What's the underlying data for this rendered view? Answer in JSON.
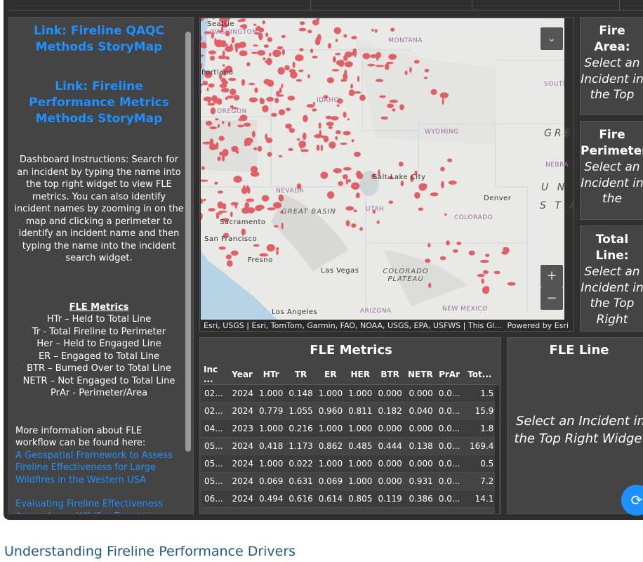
{
  "left_panel": {
    "link1": "Link: Fireline QAQC Methods StoryMap",
    "link2": "Link: Fireline Performance Metrics Methods StoryMap",
    "instructions": "Dashboard Instructions: Search for an incident by typing the name into the top right widget to view FLE metrics. You can also identify incident names by zooming in on the map and clicking a perimeter to identify an incident name and then typing the name into the incident search widget.",
    "metrics_title": "FLE Metrics",
    "metric_defs": [
      "HTr – Held to Total Line",
      "Tr - Total Fireline to Perimeter",
      "Her – Held to Engaged Line",
      "ER – Engaged to Total Line",
      "BTR – Burned Over to Total Line",
      "NETR – Not Engaged to Total Line",
      "PrAr - Perimeter/Area"
    ],
    "more_info": "More information about FLE workflow can be found here:",
    "link3": "A Geospatial Framework to Assess Fireline Effectiveness for Large Wildfires in the Western USA",
    "link4": "Evaluating Fireline Effectiveness Across Large Wildfire Events in"
  },
  "map": {
    "labels": {
      "washington": "WASHINGTON",
      "montana": "MONTANA",
      "idaho": "IDAHO",
      "oregon": "OREGON",
      "wyoming": "WYOMING",
      "nevada": "NEVADA",
      "utah": "UTAH",
      "colorado": "COLORADO",
      "arizona": "ARIZONA",
      "new_mexico": "NEW MEXICO",
      "south_dakota": "SOUTH DAKOTA",
      "nebraska": "NEBRA",
      "seattle": "Seattle",
      "portland": "Portland",
      "salt_lake": "Salt Lake City",
      "denver": "Denver",
      "sacramento": "Sacramento",
      "san_francisco": "San Francisco",
      "fresno": "Fresno",
      "las_vegas": "Las Vegas",
      "los_angeles": "Los Angeles",
      "great_basin": "GREAT BASIN",
      "colorado_plateau": "COLORADO PLATEAU",
      "great_plains": "GRE",
      "united_states": "U N",
      "united_states2": "S T A"
    },
    "attribution": "Esri, USGS | Esri, TomTom, Garmin, FAO, NOAA, USGS, EPA, USFWS | This Gl...",
    "powered_by": "Powered by Esri",
    "zoom_in": "+",
    "zoom_out": "−",
    "collapse_icon": "chevron-double-down-icon",
    "fire_color": "#e0525a"
  },
  "cards": {
    "fire_area": {
      "title": "Fire Area:",
      "subtitle": "Select an Incident in the Top"
    },
    "fire_perimeter": {
      "title": "Fire Perimeter:",
      "subtitle": "Select an Incident in the"
    },
    "total_line": {
      "title": "Total Line:",
      "subtitle": "Select an Incident in the Top Right"
    }
  },
  "metrics_table": {
    "title": "FLE Metrics",
    "headers": [
      "Inc ...",
      "Year",
      "HTr",
      "TR",
      "ER",
      "HER",
      "BTR",
      "NETR",
      "PrAr",
      "Tot..."
    ],
    "rows": [
      [
        "02...",
        "2024",
        "1.000",
        "0.148",
        "1.000",
        "1.000",
        "0.000",
        "0.000",
        "0.0...",
        "1.5"
      ],
      [
        "02...",
        "2024",
        "0.779",
        "1.055",
        "0.960",
        "0.811",
        "0.182",
        "0.040",
        "0.0...",
        "15.9"
      ],
      [
        "04...",
        "2023",
        "1.000",
        "0.216",
        "1.000",
        "1.000",
        "0.000",
        "0.000",
        "0.0...",
        "1.8"
      ],
      [
        "05...",
        "2024",
        "0.418",
        "1.173",
        "0.862",
        "0.485",
        "0.444",
        "0.138",
        "0.0...",
        "169.4"
      ],
      [
        "05...",
        "2024",
        "1.000",
        "0.022",
        "1.000",
        "1.000",
        "0.000",
        "0.000",
        "0.0...",
        "0.5"
      ],
      [
        "05...",
        "2024",
        "0.069",
        "0.631",
        "0.069",
        "1.000",
        "0.000",
        "0.931",
        "0.0...",
        "7.2"
      ],
      [
        "06...",
        "2024",
        "0.494",
        "0.616",
        "0.614",
        "0.805",
        "0.119",
        "0.386",
        "0.0...",
        "14.1"
      ]
    ]
  },
  "fle_line": {
    "title": "FLE Line",
    "message": "Select an Incident in the Top Right Widget"
  },
  "section_heading": "Understanding Fireline Performance Drivers",
  "fab_icon": "refresh-icon"
}
